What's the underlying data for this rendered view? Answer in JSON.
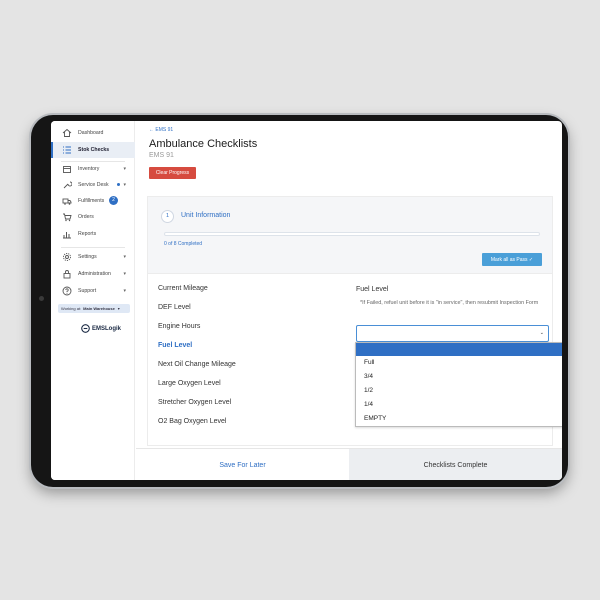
{
  "sidebar": {
    "items": [
      {
        "label": "Dashboard",
        "icon": "home-icon"
      },
      {
        "label": "Stok Checks",
        "icon": "checklist-icon",
        "active": true
      },
      {
        "label": "Inventory",
        "icon": "box-icon",
        "caret": "▾"
      },
      {
        "label": "Service Desk",
        "icon": "wrench-icon",
        "caret": "▾"
      },
      {
        "label": "Fulfillments",
        "icon": "truck-icon",
        "badge": "2"
      },
      {
        "label": "Orders",
        "icon": "cart-icon"
      },
      {
        "label": "Reports",
        "icon": "chart-icon"
      },
      {
        "label": "Settings",
        "icon": "gear-icon",
        "caret": "▾"
      },
      {
        "label": "Administration",
        "icon": "lock-icon",
        "caret": "▾"
      },
      {
        "label": "Support",
        "icon": "help-icon",
        "caret": "▾"
      }
    ],
    "working_at_label": "Working at:",
    "working_at_value": "Main Warehouse",
    "working_at_caret": "▾",
    "logo_text": "EMSLogik"
  },
  "header": {
    "breadcrumb": "← EMS 91",
    "title": "Ambulance Checklists",
    "subtitle": "EMS 91",
    "clear_button": "Clear Progress"
  },
  "section": {
    "step": "1",
    "title": "Unit Information",
    "progress_text": "0 of 8 Completed",
    "progress": 0,
    "mark_all_button": "Mark all as Pass ✓"
  },
  "checklist": {
    "items": [
      "Current Mileage",
      "DEF Level",
      "Engine Hours",
      "Fuel Level",
      "Next Oil Change Mileage",
      "Large Oxygen Level",
      "Stretcher Oxygen Level",
      "O2 Bag Oxygen Level"
    ],
    "active_index": 3
  },
  "detail": {
    "field_title": "Fuel Level",
    "note": "*If Failed, refuel unit before it is \"in service\", then resubmit Inspection Form",
    "select_value": "",
    "select_caret": "⌄",
    "options": [
      "",
      "Full",
      "3/4",
      "1/2",
      "1/4",
      "EMPTY"
    ]
  },
  "footer": {
    "save_label": "Save For Later",
    "complete_label": "Checklists Complete"
  },
  "colors": {
    "accent": "#2f6fc4",
    "danger": "#d64b3f",
    "pass": "#4a9fd8"
  }
}
